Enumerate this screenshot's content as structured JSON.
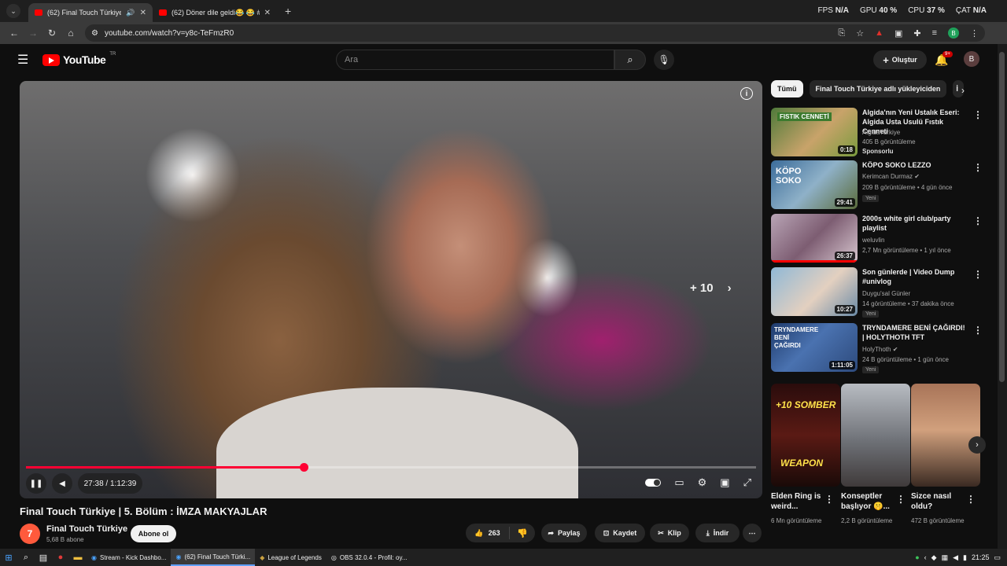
{
  "browser": {
    "tabs": [
      {
        "title": "(62) Final Touch Türkiye | 5.",
        "active": true
      },
      {
        "title": "(62) Döner dile geldi😂 😂 #sh",
        "active": false
      }
    ],
    "url": "youtube.com/watch?v=y8c-TeFmzR0",
    "stats": {
      "fps_label": "FPS",
      "fps": "N/A",
      "gpu_label": "GPU",
      "gpu": "40 %",
      "cpu_label": "CPU",
      "cpu": "37 %",
      "cat_label": "ÇAT",
      "cat": "N/A"
    },
    "profile_initial": "B"
  },
  "youtube": {
    "logo_text": "YouTube",
    "region": "TR",
    "search_placeholder": "Ara",
    "create_label": "Oluştur",
    "notifications": "9+",
    "avatar_initial": "B"
  },
  "player": {
    "time_current": "27:38",
    "time_total": "1:12:39",
    "time_display": "27:38 / 1:12:39",
    "progress": 0.38,
    "skip_label": "+ 10"
  },
  "video": {
    "title": "Final Touch Türkiye | 5. Bölüm : İMZA MAKYAJLAR",
    "channel": "Final Touch Türkiye",
    "subscribers": "5,68 B abone",
    "subscribe_label": "Abone ol",
    "likes": "263",
    "share_label": "Paylaş",
    "save_label": "Kaydet",
    "clip_label": "Klip",
    "download_label": "İndir"
  },
  "sidebar": {
    "chips": [
      "Tümü",
      "Final Touch Türkiye adlı yükleyiciden",
      "İ"
    ],
    "recommendations": [
      {
        "title": "Algida'nın Yeni Ustalık Eseri: Algida Usta Usulü Fıstık Cenneti",
        "channel": "AlgidaTurkiye",
        "meta": "405 B görüntüleme",
        "badge": "Sponsorlu",
        "duration": "0:18",
        "thumb_text": "FISTIK CENNETİ"
      },
      {
        "title": "KÖPO SOKO LEZZO",
        "channel": "Kerimcan Durmaz",
        "meta": "209 B görüntüleme • 4 gün önce",
        "badge": "Yeni",
        "duration": "29:41",
        "thumb_text": "KÖPO SOKO"
      },
      {
        "title": "2000s white girl club/party playlist",
        "channel": "weluvlin",
        "meta": "2,7 Mn görüntüleme • 1 yıl önce",
        "badge": "",
        "duration": "26:37",
        "thumb_text": ""
      },
      {
        "title": "Son günlerde | Video Dump #univlog",
        "channel": "Duygu'sal Günler",
        "meta": "14 görüntüleme • 37 dakika önce",
        "badge": "Yeni",
        "duration": "10:27",
        "thumb_text": ""
      },
      {
        "title": "TRYNDAMERE BENİ ÇAĞIRDI! | HOLYTHOTH TFT",
        "channel": "HolyThoth",
        "meta": "24 B görüntüleme • 1 gün önce",
        "badge": "Yeni",
        "duration": "1:11:05",
        "thumb_text": "TRYNDAMERE BENİ ÇAĞIRDI"
      }
    ],
    "shorts": [
      {
        "title": "Elden Ring is weird...",
        "views": "6 Mn görüntüleme",
        "thumb_top": "+10 SOMBER",
        "thumb_bottom": "WEAPON"
      },
      {
        "title": "Konseptler başlıyor 🤫...",
        "views": "2,2 B görüntüleme"
      },
      {
        "title": "Sizce nasıl oldu?",
        "views": "472 B görüntüleme"
      }
    ]
  },
  "taskbar": {
    "apps": [
      {
        "label": "Stream - Kick Dashbo...",
        "active": false
      },
      {
        "label": "(62) Final Touch Türki...",
        "active": true
      },
      {
        "label": "League of Legends",
        "active": false
      },
      {
        "label": "OBS 32.0.4 - Profil: oy...",
        "active": false
      }
    ],
    "clock": "21:25"
  },
  "colors": {
    "accent": "#ff0000",
    "progress": "#ff0033",
    "background": "#0f0f0f",
    "chip": "#272727"
  }
}
